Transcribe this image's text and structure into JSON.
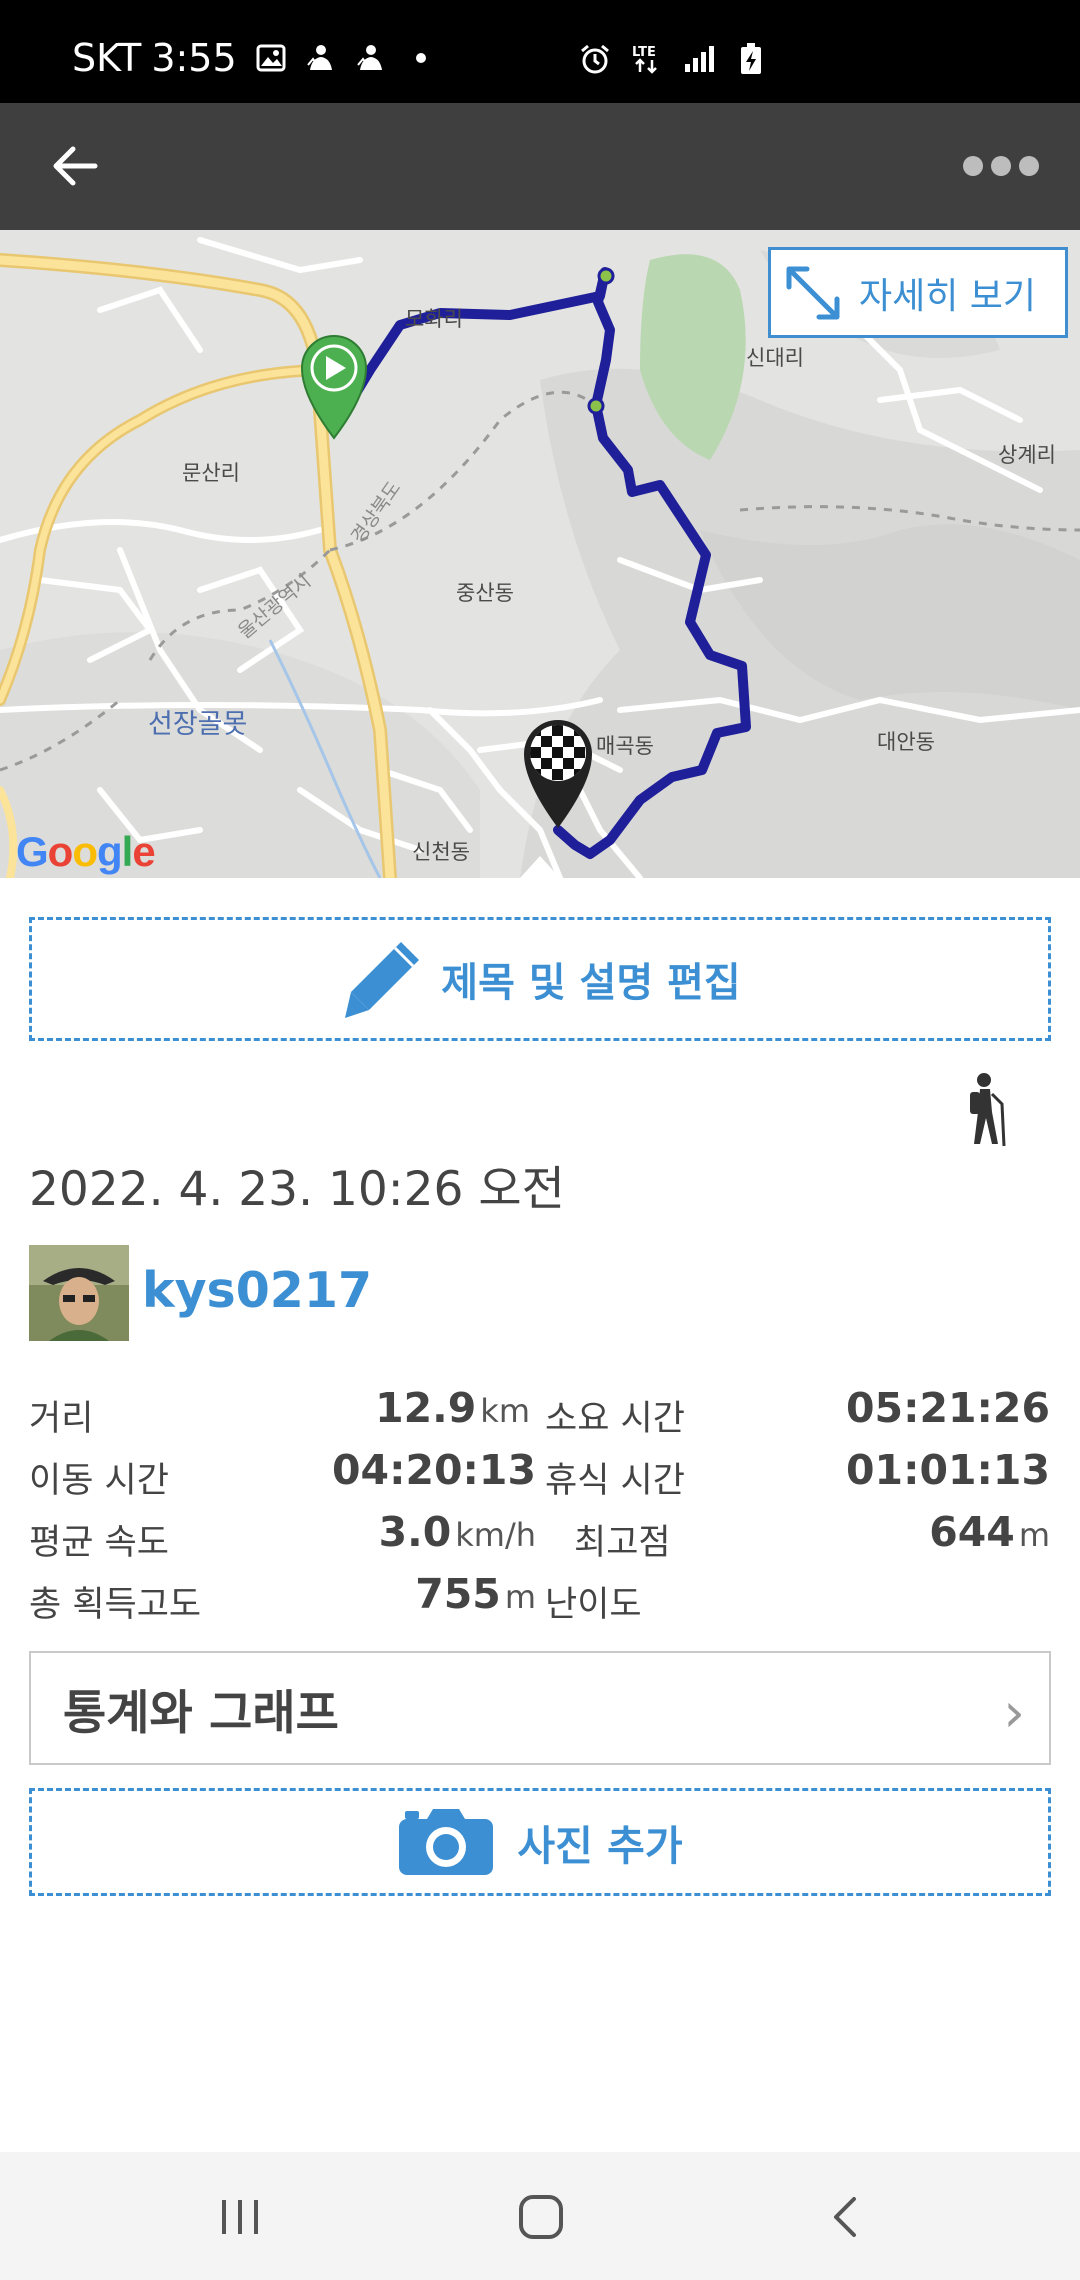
{
  "status_bar": {
    "carrier": "SKT",
    "time": "3:55",
    "left_icons": [
      "gallery-icon",
      "mountain-app-icon",
      "mountain-app-icon",
      "dot-icon"
    ],
    "right_icons": [
      "alarm-icon",
      "lte-icon",
      "signal-icon",
      "battery-charging-icon"
    ]
  },
  "app_bar": {
    "back_icon": "arrow-left-icon",
    "menu_icon": "more-horizontal-icon"
  },
  "map": {
    "detail_button_label": "자세히 보기",
    "detail_button_icon": "expand-icon",
    "logo_text": "Google",
    "labels": {
      "mohwari": "모화리",
      "sindaeri": "신대리",
      "sanggyeri": "상계리",
      "munsanri": "문산리",
      "gyeongsangbukdo": "경상북도",
      "joongsandong": "중산동",
      "ulsan": "울산광역시",
      "seonjanggolmot": "선장골못",
      "maegokdong": "매곡동",
      "daeandong": "대안동",
      "sincheondong": "신천동"
    },
    "route_color": "#1f1f9a",
    "start_marker_color": "#4caf50"
  },
  "edit_button": {
    "label": "제목 및 설명 편집",
    "icon": "pencil-icon"
  },
  "activity_icon": "hiking-icon",
  "date": "2022. 4. 23. 10:26 오전",
  "user": {
    "name": "kys0217"
  },
  "stats": {
    "distance": {
      "label": "거리",
      "value": "12.9",
      "unit": "km"
    },
    "total_time": {
      "label": "소요 시간",
      "value": "05:21:26"
    },
    "moving_time": {
      "label": "이동 시간",
      "value": "04:20:13"
    },
    "rest_time": {
      "label": "휴식 시간",
      "value": "01:01:13"
    },
    "avg_speed": {
      "label": "평균 속도",
      "value": "3.0",
      "unit": "km/h"
    },
    "max_elevation": {
      "label": "최고점",
      "value": "644",
      "unit": "m"
    },
    "elevation_gain": {
      "label": "총 획득고도",
      "value": "755",
      "unit": "m"
    },
    "difficulty": {
      "label": "난이도"
    }
  },
  "graph_button": {
    "label": "통계와 그래프",
    "chevron": "›"
  },
  "photo_button": {
    "label": "사진 추가",
    "icon": "camera-icon"
  },
  "nav_bar": {
    "recents_icon": "recents-icon",
    "home_icon": "home-icon",
    "back_icon": "nav-back-icon"
  }
}
